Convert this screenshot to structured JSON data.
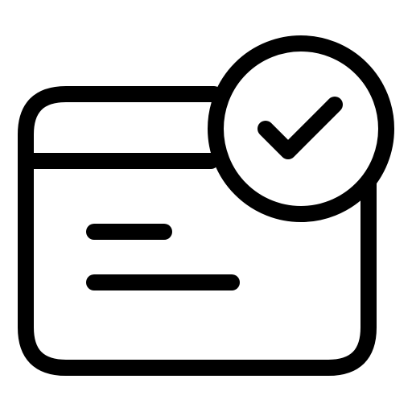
{
  "icon": {
    "name": "browser-window-check-icon",
    "stroke_color": "#000000",
    "background_color": "#ffffff",
    "parts": [
      "window-frame",
      "title-bar-divider",
      "text-lines",
      "check-badge"
    ]
  }
}
